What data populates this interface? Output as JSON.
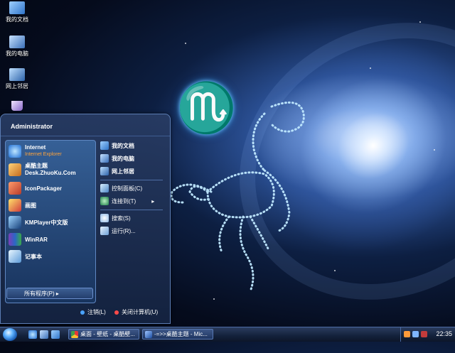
{
  "desktop": {
    "icons": [
      {
        "label": "我的文档",
        "icon": "my-documents-icon"
      },
      {
        "label": "我的电脑",
        "icon": "my-computer-icon"
      },
      {
        "label": "网上邻居",
        "icon": "network-places-icon"
      },
      {
        "label": "",
        "icon": "recycle-bin-icon"
      }
    ]
  },
  "wallpaper": {
    "zodiac_glyph": "♏"
  },
  "start_menu": {
    "user": "Administrator",
    "pinned": [
      {
        "label": "Internet",
        "sub": "Internet Explorer",
        "icon": "internet-explorer-icon"
      },
      {
        "label": "桌酷主题",
        "sub2": "Desk.ZhuoKu.Com",
        "icon": "zhuoku-theme-icon"
      },
      {
        "label": "IconPackager",
        "icon": "iconpackager-icon"
      },
      {
        "label": "画图",
        "icon": "paint-icon"
      },
      {
        "label": "KMPlayer中文版",
        "icon": "kmplayer-icon"
      },
      {
        "label": "WinRAR",
        "icon": "winrar-icon"
      },
      {
        "label": "记事本",
        "icon": "notepad-icon"
      }
    ],
    "all_programs": "所有程序(P)",
    "right_items": [
      {
        "label": "我的文档",
        "icon": "my-documents-icon"
      },
      {
        "label": "我的电脑",
        "icon": "my-computer-icon"
      },
      {
        "label": "网上邻居",
        "icon": "network-places-icon"
      },
      {
        "label": "控制面板(C)",
        "icon": "control-panel-icon"
      },
      {
        "label": "连接到(T)",
        "icon": "connect-to-icon"
      },
      {
        "label": "搜索(S)",
        "icon": "search-icon"
      },
      {
        "label": "运行(R)...",
        "icon": "run-icon"
      }
    ],
    "logoff": "注销(L)",
    "shutdown": "关闭计算机(U)"
  },
  "taskbar": {
    "tasks": [
      {
        "label": "桌面 - 壁纸 - 桌酷壁...",
        "icon": "chrome-icon"
      },
      {
        "label": "-=>>桌酷主题 - Mic...",
        "icon": "word-icon"
      }
    ],
    "clock": "22:35"
  },
  "colors": {
    "accent": "#5b7cb3",
    "subtitle_orange": "#ffa33a"
  }
}
